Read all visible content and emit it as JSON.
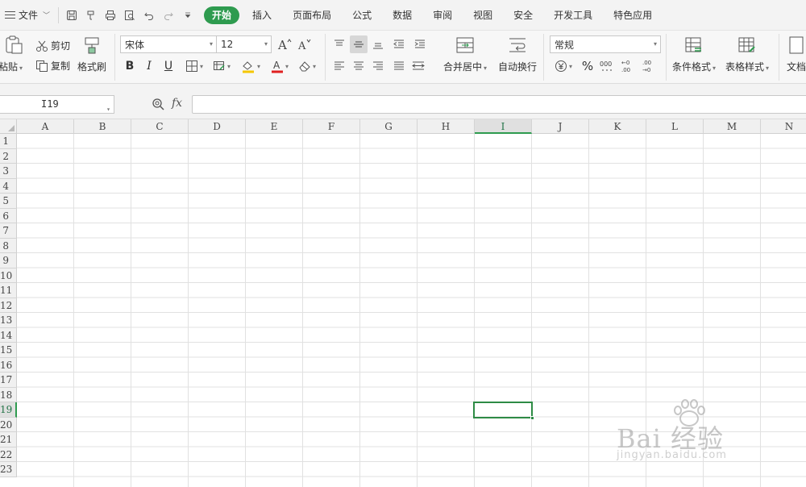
{
  "menubar": {
    "file_label": "文件",
    "tabs": [
      {
        "label": "开始",
        "active": true
      },
      {
        "label": "插入",
        "active": false
      },
      {
        "label": "页面布局",
        "active": false
      },
      {
        "label": "公式",
        "active": false
      },
      {
        "label": "数据",
        "active": false
      },
      {
        "label": "审阅",
        "active": false
      },
      {
        "label": "视图",
        "active": false
      },
      {
        "label": "安全",
        "active": false
      },
      {
        "label": "开发工具",
        "active": false
      },
      {
        "label": "特色应用",
        "active": false
      }
    ],
    "quick_access_icons": [
      "save-icon",
      "format-painter-icon",
      "print-icon",
      "print-preview-icon",
      "undo-icon",
      "redo-icon",
      "customize-icon"
    ]
  },
  "ribbon": {
    "paste_label": "粘贴",
    "cut_label": "剪切",
    "copy_label": "复制",
    "format_painter_label": "格式刷",
    "font_name": "宋体",
    "font_size": "12",
    "bold_glyph": "B",
    "italic_glyph": "I",
    "underline_glyph": "U",
    "font_color_glyph": "A",
    "merge_label": "合并居中",
    "wrap_label": "自动换行",
    "number_format": "常规",
    "percent_glyph": "%",
    "conditional_format_label": "条件格式",
    "table_style_label": "表格样式",
    "doc_label": "文档"
  },
  "formula_bar": {
    "name_box": "I19",
    "fx_label": "fx",
    "formula": ""
  },
  "sheet": {
    "columns": [
      "A",
      "B",
      "C",
      "D",
      "E",
      "F",
      "G",
      "H",
      "I",
      "J",
      "K",
      "L",
      "M",
      "N"
    ],
    "rows": [
      "1",
      "2",
      "3",
      "4",
      "5",
      "6",
      "7",
      "8",
      "9",
      "10",
      "11",
      "12",
      "13",
      "14",
      "15",
      "16",
      "17",
      "18",
      "19",
      "20",
      "21",
      "22",
      "23"
    ],
    "selected_column": "I",
    "selected_row": "19"
  },
  "watermark": {
    "text": "Bai  经验",
    "sub": "jingyan.baidu.com"
  },
  "colors": {
    "accent": "#2e9b4f",
    "selection": "#2e8b45",
    "gridline": "#e1e1e1",
    "header_bg": "#f0f0f0"
  }
}
